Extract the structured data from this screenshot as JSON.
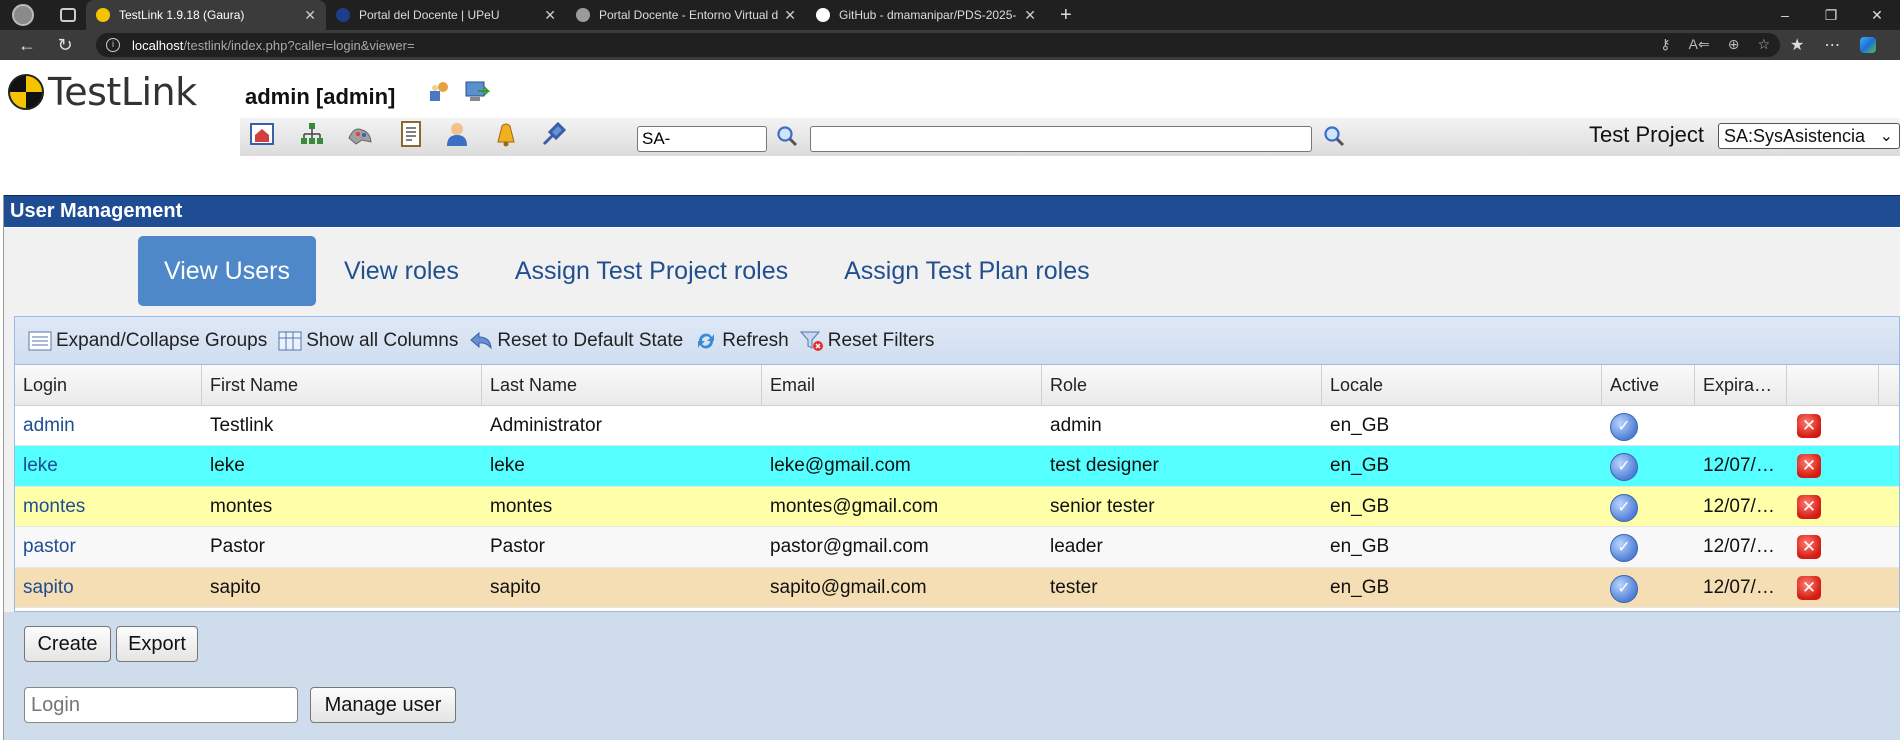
{
  "browser": {
    "tabs": [
      {
        "title": "TestLink 1.9.18 (Gaura)",
        "active": true,
        "favicon_color": "#f5c400"
      },
      {
        "title": "Portal del Docente | UPeU",
        "active": false,
        "favicon_color": "#1d3f8a"
      },
      {
        "title": "Portal Docente - Entorno Virtual d",
        "active": false,
        "favicon_color": "#9b9b9b"
      },
      {
        "title": "GitHub - dmamanipar/PDS-2025-",
        "active": false,
        "favicon_color": "#ffffff"
      }
    ],
    "url_host": "localhost",
    "url_path": "/testlink/index.php?caller=login&viewer="
  },
  "header": {
    "logo_text": "TestLink",
    "user": "admin [admin]",
    "tc_prefix": "SA-",
    "search_value": "",
    "project_label": "Test Project",
    "project_selected": "SA:SysAsistencia"
  },
  "section_title": "User Management",
  "page_tabs": [
    {
      "label": "View Users",
      "active": true
    },
    {
      "label": "View roles",
      "active": false
    },
    {
      "label": "Assign Test Project roles",
      "active": false
    },
    {
      "label": "Assign Test Plan roles",
      "active": false
    }
  ],
  "grid_toolbar": {
    "expand": "Expand/Collapse Groups",
    "show_columns": "Show all Columns",
    "reset_default": "Reset to Default State",
    "refresh": "Refresh",
    "reset_filters": "Reset Filters"
  },
  "columns": [
    "Login",
    "First Name",
    "Last Name",
    "Email",
    "Role",
    "Locale",
    "Active",
    "Expira…",
    ""
  ],
  "users": [
    {
      "login": "admin",
      "first": "Testlink",
      "last": "Administrator",
      "email": "",
      "role": "admin",
      "locale": "en_GB",
      "active": true,
      "expiration": "",
      "row_color": "#ffffff"
    },
    {
      "login": "leke",
      "first": "leke",
      "last": "leke",
      "email": "leke@gmail.com",
      "role": "test designer",
      "locale": "en_GB",
      "active": true,
      "expiration": "12/07/…",
      "row_color": "#55ffff"
    },
    {
      "login": "montes",
      "first": "montes",
      "last": "montes",
      "email": "montes@gmail.com",
      "role": "senior tester",
      "locale": "en_GB",
      "active": true,
      "expiration": "12/07/…",
      "row_color": "#ffffaa"
    },
    {
      "login": "pastor",
      "first": "Pastor",
      "last": "Pastor",
      "email": "pastor@gmail.com",
      "role": "leader",
      "locale": "en_GB",
      "active": true,
      "expiration": "12/07/…",
      "row_color": "#f8f8f8"
    },
    {
      "login": "sapito",
      "first": "sapito",
      "last": "sapito",
      "email": "sapito@gmail.com",
      "role": "tester",
      "locale": "en_GB",
      "active": true,
      "expiration": "12/07/…",
      "row_color": "#f5deb3"
    }
  ],
  "actions": {
    "create": "Create",
    "export": "Export",
    "login_placeholder": "Login",
    "manage_user": "Manage user"
  }
}
